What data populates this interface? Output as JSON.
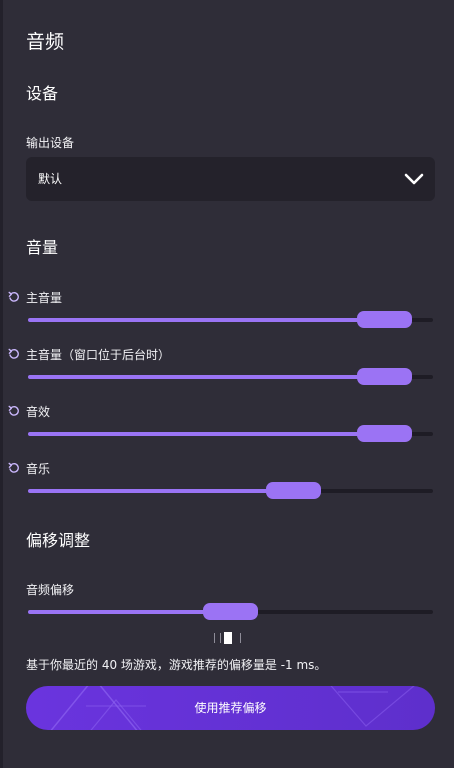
{
  "page": {
    "title": "音频"
  },
  "device": {
    "heading": "设备",
    "output_label": "输出设备",
    "output_value": "默认"
  },
  "volume": {
    "heading": "音量",
    "sliders": [
      {
        "label": "主音量",
        "level": 0.94
      },
      {
        "label": "主音量（窗口位于后台时）",
        "level": 0.94
      },
      {
        "label": "音效",
        "level": 0.94
      },
      {
        "label": "音乐",
        "level": 0.68
      }
    ]
  },
  "offset": {
    "heading": "偏移调整",
    "label": "音频偏移",
    "level": 0.5,
    "note": "基于你最近的 40 场游戏，游戏推荐的偏移量是 -1 ms。",
    "apply_label": "使用推荐偏移"
  },
  "colors": {
    "background": "#2f2d38",
    "accent": "#9b73f4",
    "button": "#6a34de"
  }
}
